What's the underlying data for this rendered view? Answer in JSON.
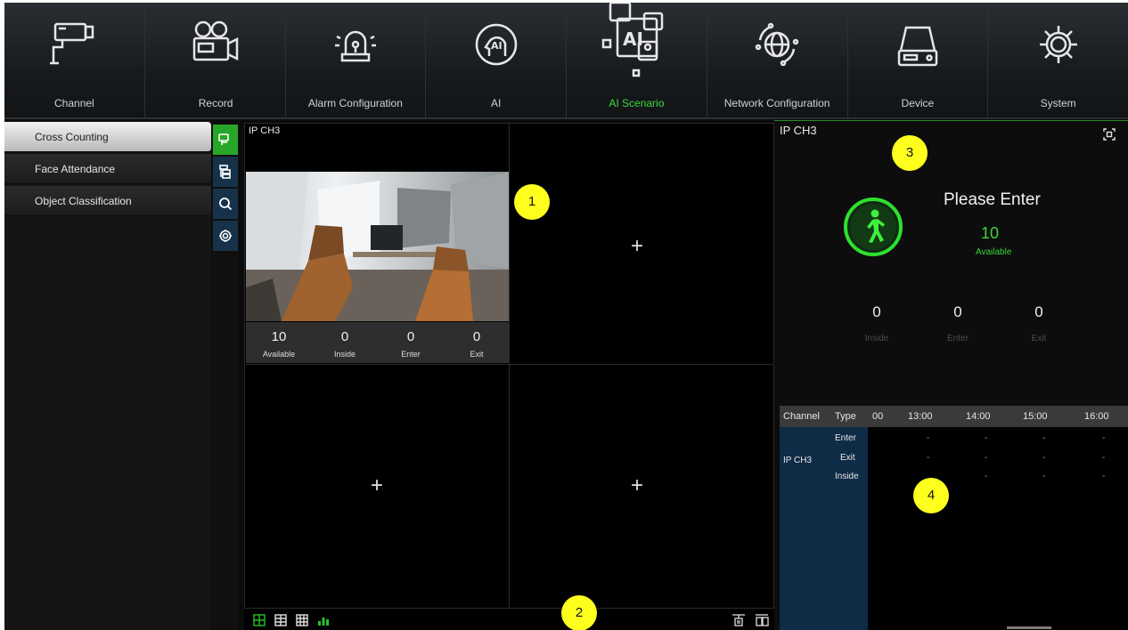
{
  "nav": {
    "items": [
      {
        "label": "Channel",
        "icon": "camera-icon"
      },
      {
        "label": "Record",
        "icon": "video-camera-icon"
      },
      {
        "label": "Alarm Configuration",
        "icon": "alarm-light-icon"
      },
      {
        "label": "AI",
        "icon": "ai-head-icon"
      },
      {
        "label": "AI Scenario",
        "icon": "ai-scenario-icon"
      },
      {
        "label": "Network Configuration",
        "icon": "globe-icon"
      },
      {
        "label": "Device",
        "icon": "hard-disk-icon"
      },
      {
        "label": "System",
        "icon": "gear-icon"
      }
    ],
    "active": "AI Scenario",
    "active_color": "#3fd63f"
  },
  "left_menu": {
    "items": [
      "Cross Counting",
      "Face Attendance",
      "Object Classification"
    ],
    "selected": "Cross Counting"
  },
  "tools": [
    "cross-counting-icon",
    "channel-list-icon",
    "search-icon",
    "settings-icon"
  ],
  "grid": {
    "channel_label": "IP CH3",
    "stats": [
      {
        "value": "10",
        "label": "Available"
      },
      {
        "value": "0",
        "label": "Inside"
      },
      {
        "value": "0",
        "label": "Enter"
      },
      {
        "value": "0",
        "label": "Exit"
      }
    ],
    "empty_cell_symbol": "+"
  },
  "right_panel": {
    "title": "IP CH3",
    "message": "Please Enter",
    "available_value": "10",
    "available_label": "Available",
    "stats": [
      {
        "value": "0",
        "label": "Inside"
      },
      {
        "value": "0",
        "label": "Enter"
      },
      {
        "value": "0",
        "label": "Exit"
      }
    ],
    "table": {
      "headers": [
        "Channel",
        "Type",
        "00",
        "13:00",
        "14:00",
        "15:00",
        "16:00"
      ],
      "channel": "IP CH3",
      "types": [
        "Enter",
        "Exit",
        "Inside"
      ],
      "empty_value": "-"
    }
  },
  "callouts": [
    "1",
    "2",
    "3",
    "4"
  ],
  "colors": {
    "accent_green": "#28a628",
    "callout_yellow": "#ffff1e",
    "tool_blue": "#16324a"
  }
}
